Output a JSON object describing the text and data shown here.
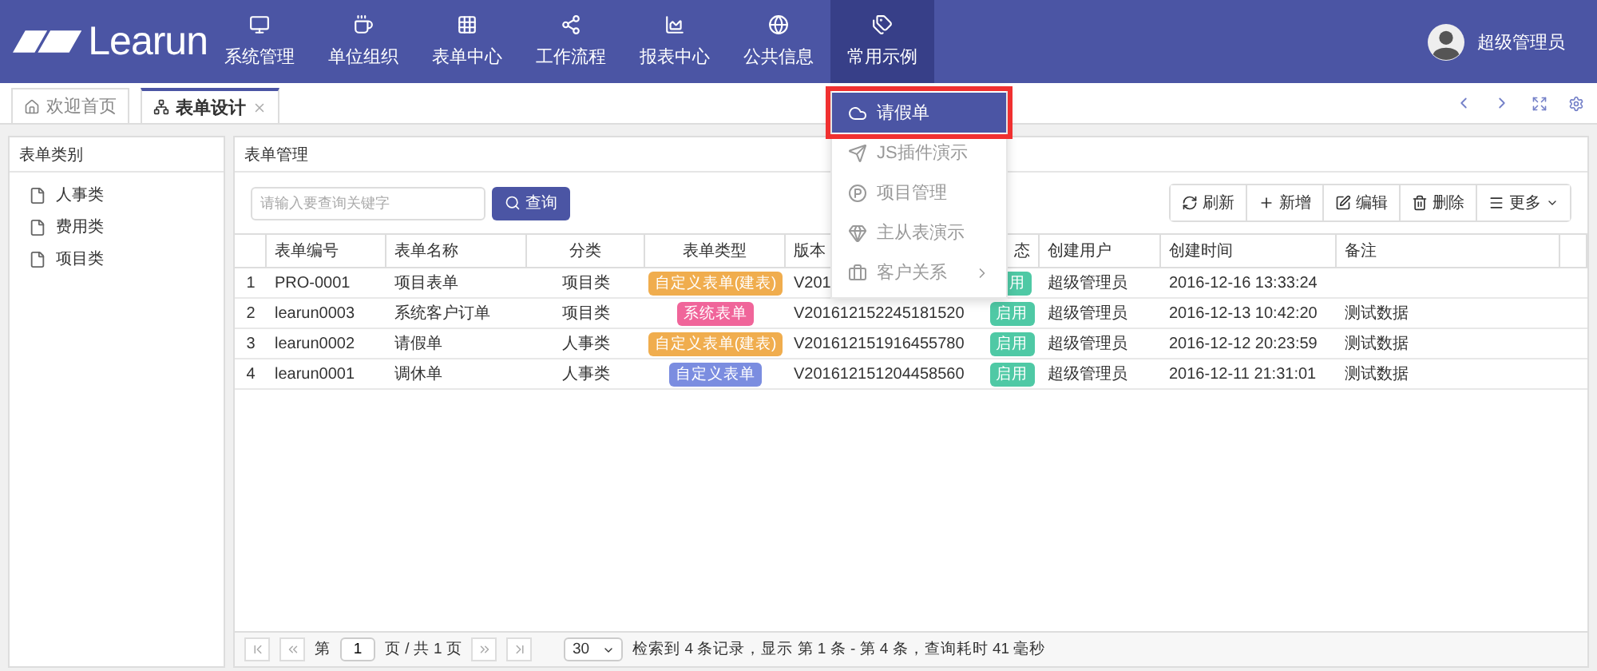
{
  "logo": {
    "text": "Learun"
  },
  "nav": [
    {
      "label": "系统管理",
      "selected": false
    },
    {
      "label": "单位组织",
      "selected": false
    },
    {
      "label": "表单中心",
      "selected": false
    },
    {
      "label": "工作流程",
      "selected": false
    },
    {
      "label": "报表中心",
      "selected": false
    },
    {
      "label": "公共信息",
      "selected": false
    },
    {
      "label": "常用示例",
      "selected": true
    }
  ],
  "user": {
    "name": "超级管理员"
  },
  "dropdown": [
    {
      "label": "请假单",
      "selected": true,
      "submenu": false
    },
    {
      "label": "JS插件演示",
      "selected": false,
      "submenu": false
    },
    {
      "label": "项目管理",
      "selected": false,
      "submenu": false
    },
    {
      "label": "主从表演示",
      "selected": false,
      "submenu": false
    },
    {
      "label": "客户关系",
      "selected": false,
      "submenu": true
    }
  ],
  "tabs": [
    {
      "label": "欢迎首页",
      "selected": false,
      "closable": false
    },
    {
      "label": "表单设计",
      "selected": true,
      "closable": true
    }
  ],
  "sidebar": {
    "title": "表单类别",
    "items": [
      "人事类",
      "费用类",
      "项目类"
    ]
  },
  "main": {
    "title": "表单管理",
    "search": {
      "placeholder": "请输入要查询关键字",
      "button": "查询"
    },
    "toolbar": [
      {
        "label": "刷新",
        "caret": false
      },
      {
        "label": "新增",
        "caret": false
      },
      {
        "label": "编辑",
        "caret": false
      },
      {
        "label": "删除",
        "caret": false
      },
      {
        "label": "更多",
        "caret": true
      }
    ]
  },
  "table": {
    "columns": [
      "",
      "表单编号",
      "表单名称",
      "分类",
      "表单类型",
      "版本",
      "态",
      "创建用户",
      "创建时间",
      "备注"
    ],
    "rows": [
      {
        "no": "1",
        "code": "PRO-0001",
        "name": "项目表单",
        "category": "项目类",
        "type": {
          "text": "自定义表单(建表)",
          "color": "#f0ad4e"
        },
        "version": "V201",
        "status": {
          "text": "用",
          "color": "#4fc9a5"
        },
        "user": "超级管理员",
        "time": "2016-12-16 13:33:24",
        "note": ""
      },
      {
        "no": "2",
        "code": "learun0003",
        "name": "系统客户订单",
        "category": "项目类",
        "type": {
          "text": "系统表单",
          "color": "#f0659a"
        },
        "version": "V201612152245181520",
        "status": {
          "text": "启用",
          "color": "#4fc9a5"
        },
        "user": "超级管理员",
        "time": "2016-12-13 10:42:20",
        "note": "测试数据"
      },
      {
        "no": "3",
        "code": "learun0002",
        "name": "请假单",
        "category": "人事类",
        "type": {
          "text": "自定义表单(建表)",
          "color": "#f0ad4e"
        },
        "version": "V201612151916455780",
        "status": {
          "text": "启用",
          "color": "#4fc9a5"
        },
        "user": "超级管理员",
        "time": "2016-12-12 20:23:59",
        "note": "测试数据"
      },
      {
        "no": "4",
        "code": "learun0001",
        "name": "调休单",
        "category": "人事类",
        "type": {
          "text": "自定义表单",
          "color": "#7b8de0"
        },
        "version": "V201612151204458560",
        "status": {
          "text": "启用",
          "color": "#4fc9a5"
        },
        "user": "超级管理员",
        "time": "2016-12-11 21:31:01",
        "note": "测试数据"
      }
    ]
  },
  "pager": {
    "prefix": "第",
    "page": "1",
    "suffix": "页 / 共 1 页",
    "size": "30",
    "summary": "检索到 4 条记录，显示 第 1 条 - 第 4 条，查询耗时 41 毫秒"
  }
}
